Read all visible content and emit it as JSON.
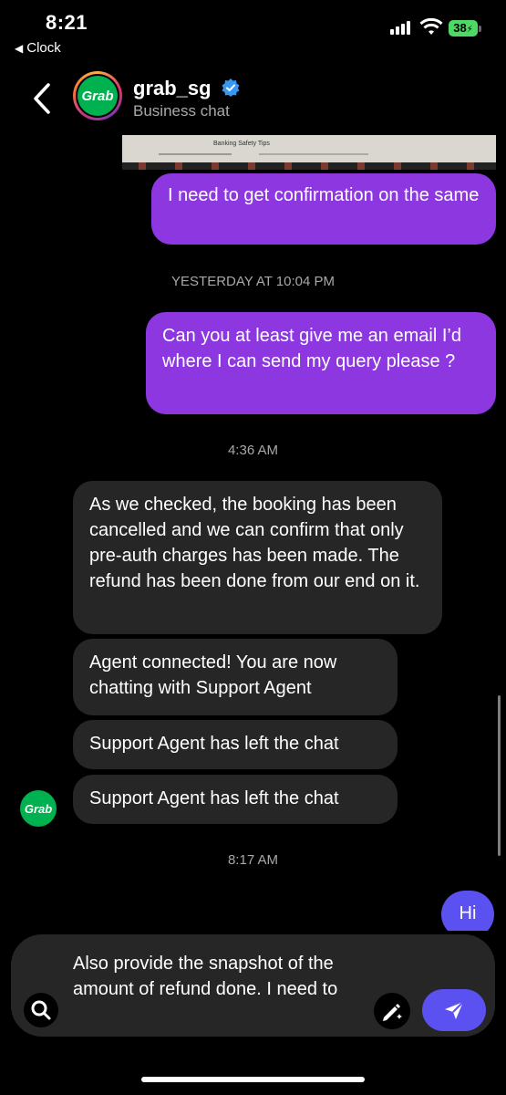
{
  "status_bar": {
    "time": "8:21",
    "back_app": "Clock",
    "battery": "38"
  },
  "header": {
    "name": "grab_sg",
    "subtitle": "Business chat",
    "avatar_text": "Grab",
    "verified_color": "#3897f0"
  },
  "chat": {
    "image_preview_caption": "Banking Safety Tips",
    "messages": [
      {
        "side": "out",
        "text": "I need to get confirmation on the same"
      },
      {
        "side": "timestamp",
        "text": "YESTERDAY AT 10:04 PM"
      },
      {
        "side": "out",
        "text": "Can you at least give me an email I’d where I can send my query please ?"
      },
      {
        "side": "timestamp",
        "text": "4:36 AM"
      },
      {
        "side": "in",
        "text": "As we checked, the booking has been cancelled and we can confirm that only pre-auth charges has been made. The refund has been done from our end on it."
      },
      {
        "side": "in",
        "text": "Agent connected! You are now chatting with Support Agent"
      },
      {
        "side": "in",
        "text": "Support Agent has left the chat"
      },
      {
        "side": "in",
        "text": "Support Agent has left the chat"
      },
      {
        "side": "timestamp",
        "text": "8:17 AM"
      },
      {
        "side": "out",
        "text": "Hi"
      }
    ],
    "sender_avatar_text": "Grab"
  },
  "composer": {
    "draft": "Also provide the snapshot of the amount of refund done. I need to"
  },
  "colors": {
    "outgoing": "#8c37e0",
    "outgoing_latest": "#5b51f0",
    "incoming": "#262626",
    "grab_green": "#00b14f"
  }
}
